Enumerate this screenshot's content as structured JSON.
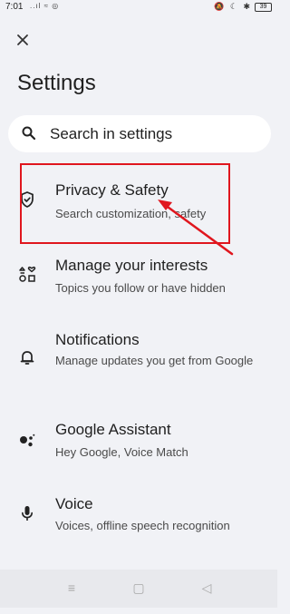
{
  "status_bar": {
    "time": "7:01",
    "left_icons": "..ıl ≈ ◎",
    "right_icons": "🔕 ☾ ✱",
    "battery": "39"
  },
  "header": {
    "title": "Settings"
  },
  "search": {
    "placeholder": "Search in settings"
  },
  "items": [
    {
      "title": "Privacy & Safety",
      "subtitle": "Search customization, safety",
      "icon": "shield-icon"
    },
    {
      "title": "Manage your interests",
      "subtitle": "Topics you follow or have hidden",
      "icon": "interests-icon"
    },
    {
      "title": "Notifications",
      "subtitle": "Manage updates you get from Google",
      "icon": "bell-icon"
    },
    {
      "title": "Google Assistant",
      "subtitle": "Hey Google, Voice Match",
      "icon": "assistant-icon"
    },
    {
      "title": "Voice",
      "subtitle": "Voices, offline speech recognition",
      "icon": "mic-icon"
    }
  ],
  "annotation": {
    "color": "#e0161e"
  },
  "nav": {
    "menu": "≡",
    "home": "▢",
    "back": "◁"
  }
}
